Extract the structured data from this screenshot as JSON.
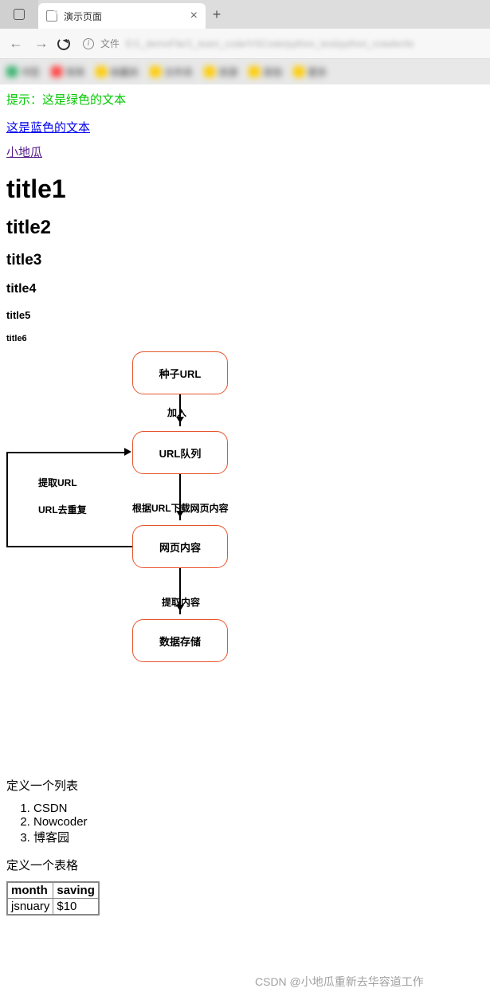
{
  "browser": {
    "tab_title": "演示页面",
    "tab_close": "×",
    "tab_add": "+",
    "addr_label": "文件",
    "addr_blur": "E/1_demoFile/1_team_code/VSCode/python_test/python_crawler/te"
  },
  "page": {
    "green_text": "提示：这是绿色的文本",
    "blue_link": "这是蓝色的文本",
    "purple_link": "小地瓜",
    "h1": "title1",
    "h2": "title2",
    "h3": "title3",
    "h4": "title4",
    "h5": "title5",
    "h6": "title6",
    "list_label": "定义一个列表",
    "list_items": [
      "CSDN",
      "Nowcoder",
      "博客园"
    ],
    "table_label": "定义一个表格",
    "table": {
      "headers": [
        "month",
        "saving"
      ],
      "row": [
        "jsnuary",
        "$10"
      ]
    }
  },
  "flowchart": {
    "box1": "种子URL",
    "label1": "加入",
    "box2": "URL队列",
    "label2": "根据URL下载网页内容",
    "box3": "网页内容",
    "label3": "提取内容",
    "box4": "数据存储",
    "side1": "提取URL",
    "side2": "URL去重复"
  },
  "watermark": "CSDN @小地瓜重新去华容道工作"
}
